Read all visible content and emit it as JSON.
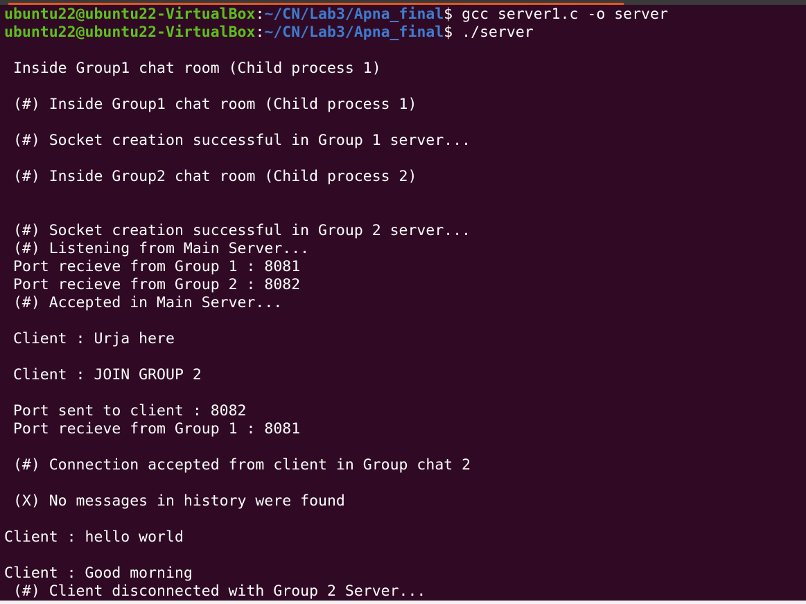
{
  "terminal": {
    "prompt": {
      "user_host": "ubuntu22@ubuntu22-VirtualBox",
      "separator": ":",
      "path": "~/CN/Lab3/Apna_final",
      "symbol": "$"
    },
    "commands": [
      " gcc server1.c -o server",
      " ./server"
    ],
    "output": [
      "",
      " Inside Group1 chat room (Child process 1)",
      "",
      " (#) Inside Group1 chat room (Child process 1)",
      "",
      " (#) Socket creation successful in Group 1 server...",
      "",
      " (#) Inside Group2 chat room (Child process 2)",
      "",
      "",
      " (#) Socket creation successful in Group 2 server...",
      " (#) Listening from Main Server...",
      " Port recieve from Group 1 : 8081",
      " Port recieve from Group 2 : 8082",
      " (#) Accepted in Main Server...",
      "",
      " Client : Urja here",
      "",
      " Client : JOIN GROUP 2",
      "",
      " Port sent to client : 8082",
      " Port recieve from Group 1 : 8081",
      "",
      " (#) Connection accepted from client in Group chat 2",
      "",
      " (X) No messages in history were found",
      "",
      "Client : hello world",
      "",
      "Client : Good morning",
      " (#) Client disconnected with Group 2 Server..."
    ]
  },
  "colors": {
    "background": "#300a24",
    "user_host": "#5fbf1c",
    "path": "#3f7bd0",
    "text": "#ffffff",
    "tab_accent": "#e95420"
  }
}
